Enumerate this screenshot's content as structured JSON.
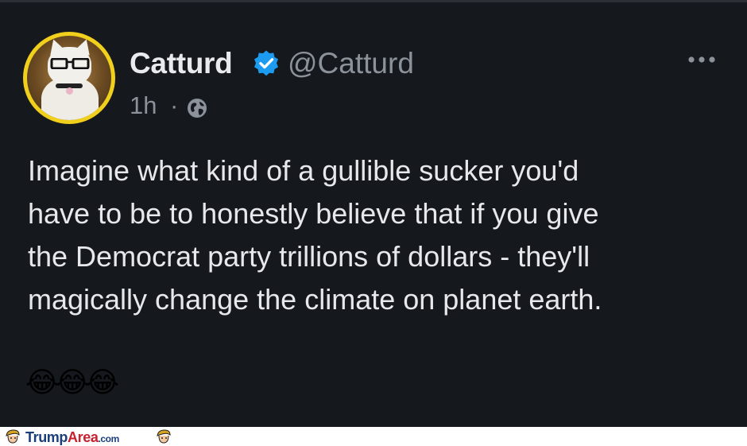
{
  "tweet": {
    "display_name": "Catturd",
    "handle": "@Catturd",
    "time": "1h",
    "separator": "·",
    "body_lines": [
      "Imagine what kind of a gullible sucker you'd",
      "have to be to honestly believe that if you give",
      "the Democrat party trillions of dollars - they'll",
      "magically change the climate on planet earth."
    ],
    "emojis": "😂😂😂",
    "colors": {
      "background": "#15181d",
      "avatar_ring": "#f0cf1d",
      "verified": "#1d9bf0"
    },
    "icons": {
      "verified": "verified-badge-icon",
      "audience": "globe-icon",
      "more": "more-options-icon"
    }
  },
  "footer": {
    "brand_part1": "Trump",
    "brand_part2": "Area",
    "brand_part3": ".com"
  }
}
